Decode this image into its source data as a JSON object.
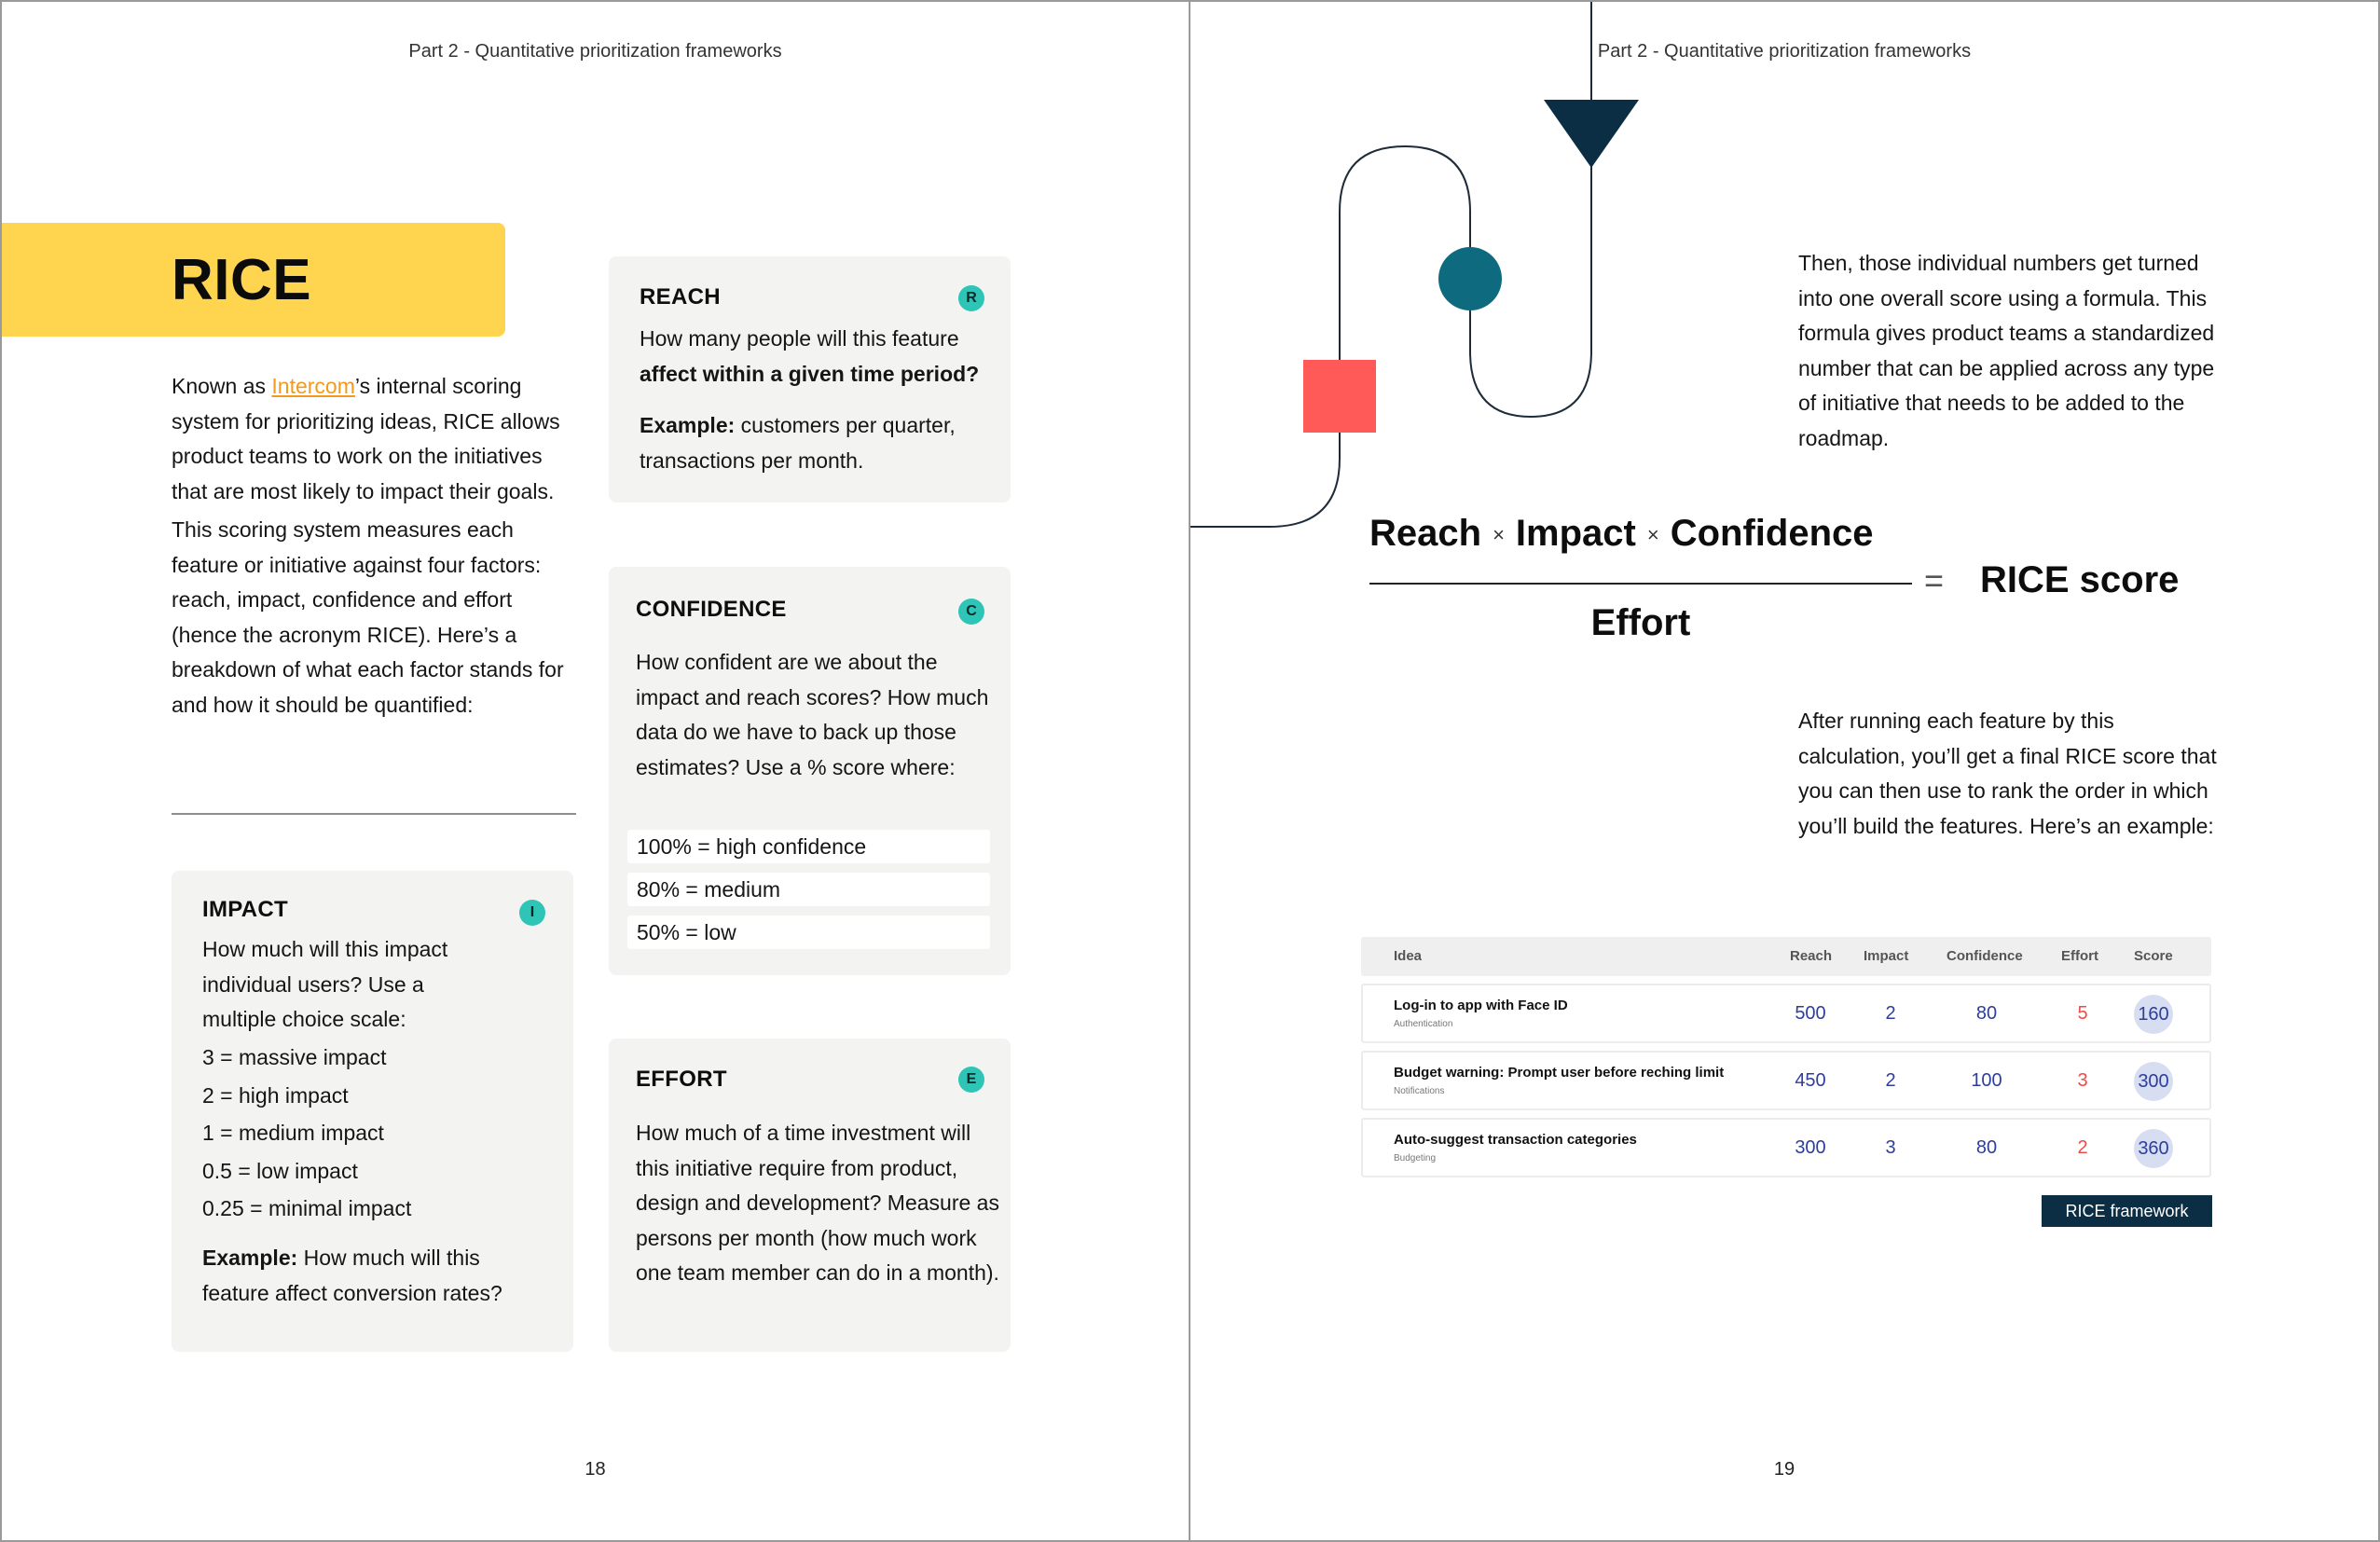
{
  "left_page": {
    "running_head": "Part 2 - Quantitative prioritization frameworks",
    "title": "RICE",
    "intro": {
      "prefix": "Known as ",
      "link": "Intercom",
      "suffix": "’s internal scoring system for prioritizing ideas, RICE allows product teams to work on the initiatives that are most likely to impact their goals.",
      "paragraph2": "This scoring system measures each feature or initiative against four factors: reach, impact, confidence and effort (hence the acronym RICE). Here’s a breakdown of what each factor stands for and how it should be quantified:"
    },
    "reach": {
      "heading": "REACH",
      "badge": "R",
      "question": "How many people will this feature ",
      "question_bold": "affect within a given time period?",
      "example_label": "Example:",
      "example_text": " customers per quarter, transactions per month."
    },
    "confidence": {
      "heading": "CONFIDENCE",
      "badge": "C",
      "body": "How confident are we about the impact and reach scores? How much data do we have to back up those estimates? Use a % score where:",
      "scores": [
        "100% = high confidence",
        "80% = medium",
        "50% = low"
      ]
    },
    "effort": {
      "heading": "EFFORT",
      "badge": "E",
      "body": "How much of a time investment will this initiative require from product, design and development? Measure as persons per month (how much work one team member can do in a month)."
    },
    "impact": {
      "heading": "IMPACT",
      "badge": "I",
      "body": "How much will this impact individual users? Use a multiple choice scale:",
      "scale": [
        "3 = massive impact",
        "2 = high impact",
        "1 = medium impact",
        "0.5 = low impact",
        "0.25 = minimal impact"
      ],
      "example_label": "Example:",
      "example_text": " How much will this feature affect conversion rates?"
    },
    "page_number": "18"
  },
  "right_page": {
    "running_head": "Part 2 - Quantitative prioritization frameworks",
    "para1": "Then, those individual numbers get turned into one overall score using a formula. This formula gives product teams a standardized number that can be applied across any type of initiative that needs to be added to the roadmap.",
    "formula": {
      "term1": "Reach",
      "term2": "Impact",
      "term3": "Confidence",
      "times": "×",
      "denominator": "Effort",
      "equals": "=",
      "result": "RICE score"
    },
    "para2": "After running each feature by this calculation, you’ll get a final RICE score that you can then use to rank the order in which you’ll build the features. Here’s an example:",
    "table": {
      "headers": {
        "idea": "Idea",
        "reach": "Reach",
        "impact": "Impact",
        "confidence": "Confidence",
        "effort": "Effort",
        "score": "Score"
      },
      "rows": [
        {
          "idea": "Log-in to app with Face ID",
          "category": "Authentication",
          "reach": "500",
          "impact": "2",
          "confidence": "80",
          "effort": "5",
          "score": "160"
        },
        {
          "idea": "Budget warning: Prompt user before reching limit",
          "category": "Notifications",
          "reach": "450",
          "impact": "2",
          "confidence": "100",
          "effort": "3",
          "score": "300"
        },
        {
          "idea": "Auto-suggest transaction categories",
          "category": "Budgeting",
          "reach": "300",
          "impact": "3",
          "confidence": "80",
          "effort": "2",
          "score": "360"
        }
      ]
    },
    "caption": "RICE framework",
    "page_number": "19"
  },
  "colors": {
    "title_band": "#ffd44f",
    "badge": "#2ec4b6",
    "card_bg": "#f3f3f1",
    "link": "#f39a1e",
    "table_number": "#2d3e9c",
    "effort_number": "#ef4a44",
    "score_circle": "#d8def1",
    "caption_bg": "#0b2e44",
    "triangle": "#0b2e44",
    "circle": "#0e6a7e",
    "square": "#ff5a57"
  }
}
